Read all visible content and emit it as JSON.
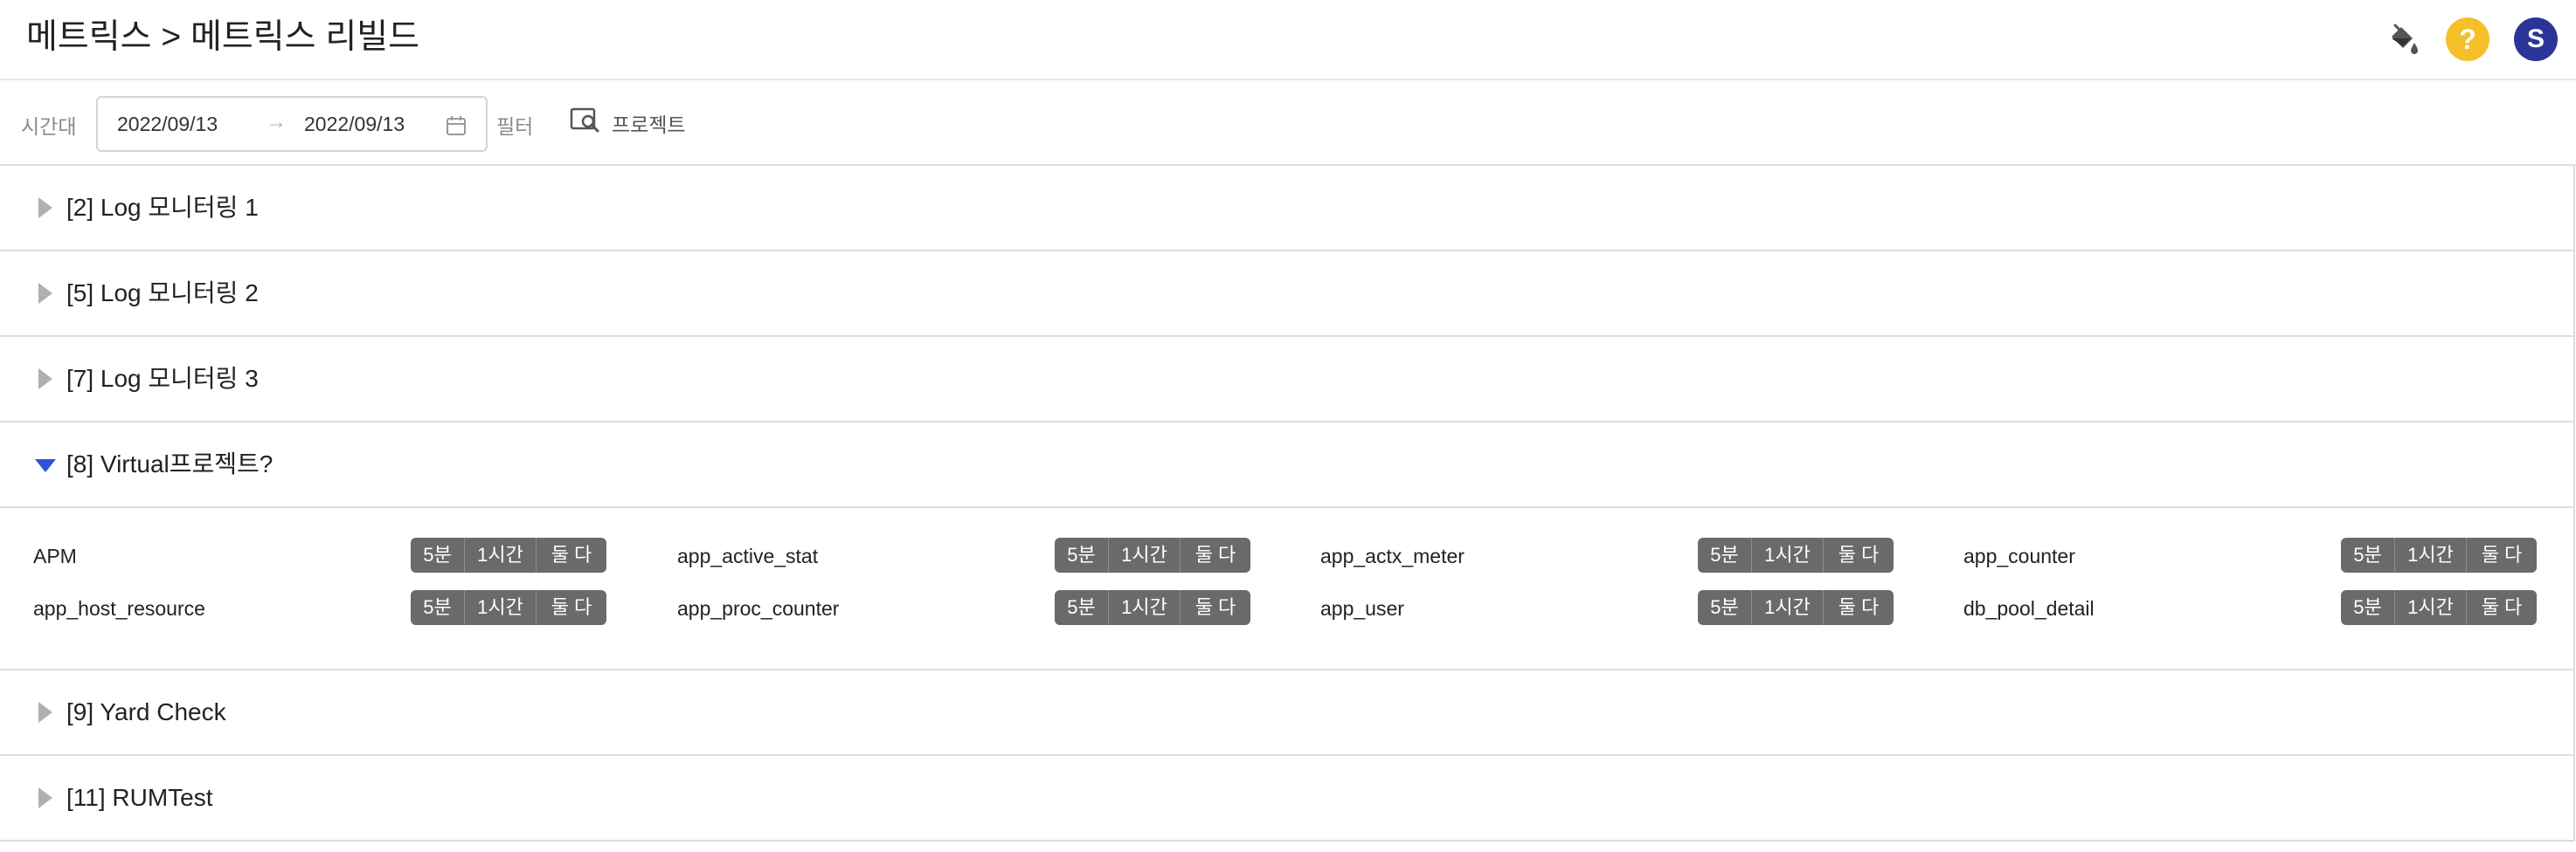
{
  "header": {
    "title": "메트릭스 > 메트릭스 리빌드",
    "icons": [
      "paint-bucket-icon",
      "help-icon",
      "avatar"
    ],
    "help_glyph": "?",
    "avatar_initial": "S",
    "colors": {
      "help": "#f5bf2a",
      "avatar": "#2a3499"
    }
  },
  "filter_bar": {
    "time_label": "시간대",
    "date_start": "2022/09/13",
    "date_end": "2022/09/13",
    "range_arrow": "→",
    "filter_label": "필터",
    "project_button": "프로젝트"
  },
  "projects": [
    {
      "title": "[2] Log 모니터링 1",
      "expanded": false
    },
    {
      "title": "[5] Log 모니터링 2",
      "expanded": false
    },
    {
      "title": "[7] Log 모니터링 3",
      "expanded": false
    },
    {
      "title": "[8] Virtual프로젝트?",
      "expanded": true
    },
    {
      "title": "[9] Yard Check",
      "expanded": false
    },
    {
      "title": "[11] RUMTest",
      "expanded": false
    }
  ],
  "rebuild_buttons": {
    "five_min": "5분",
    "one_hour": "1시간",
    "both": "둘 다"
  },
  "metrics": [
    "APM",
    "app_active_stat",
    "app_actx_meter",
    "app_counter",
    "app_host_resource",
    "app_proc_counter",
    "app_user",
    "db_pool_detail"
  ],
  "colors": {
    "expanded_caret": "#2f55d4",
    "button_group": "#6a6a6a"
  }
}
